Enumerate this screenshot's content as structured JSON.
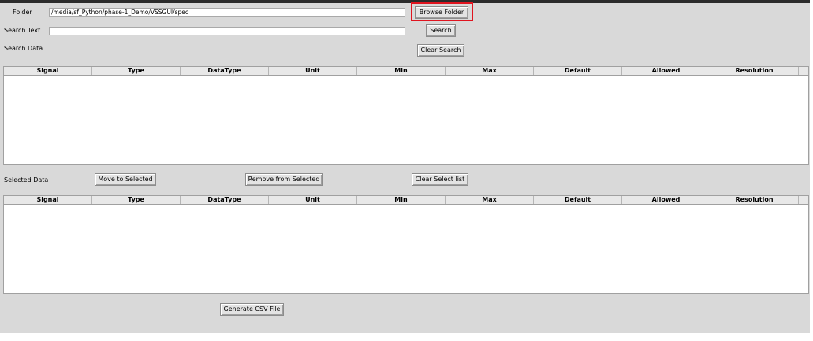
{
  "folder": {
    "label": "Folder",
    "value": "/media/sf_Python/phase-1_Demo/VSSGUI/spec",
    "browse_label": "Browse Folder"
  },
  "search": {
    "label": "Search Text",
    "value": "",
    "button_label": "Search"
  },
  "search_data": {
    "label": "Search Data",
    "clear_label": "Clear Search",
    "columns": [
      "Signal",
      "Type",
      "DataType",
      "Unit",
      "Min",
      "Max",
      "Default",
      "Allowed",
      "Resolution"
    ],
    "rows": []
  },
  "selected_data": {
    "label": "Selected Data",
    "move_label": "Move to Selected",
    "remove_label": "Remove from Selected",
    "clear_label": "Clear Select list",
    "columns": [
      "Signal",
      "Type",
      "DataType",
      "Unit",
      "Min",
      "Max",
      "Default",
      "Allowed",
      "Resolution"
    ],
    "rows": []
  },
  "footer": {
    "generate_label": "Generate CSV File"
  },
  "colors": {
    "window_bg": "#d9d9d9",
    "highlight": "#e0141f",
    "title_bar": "#2b2b2b"
  }
}
